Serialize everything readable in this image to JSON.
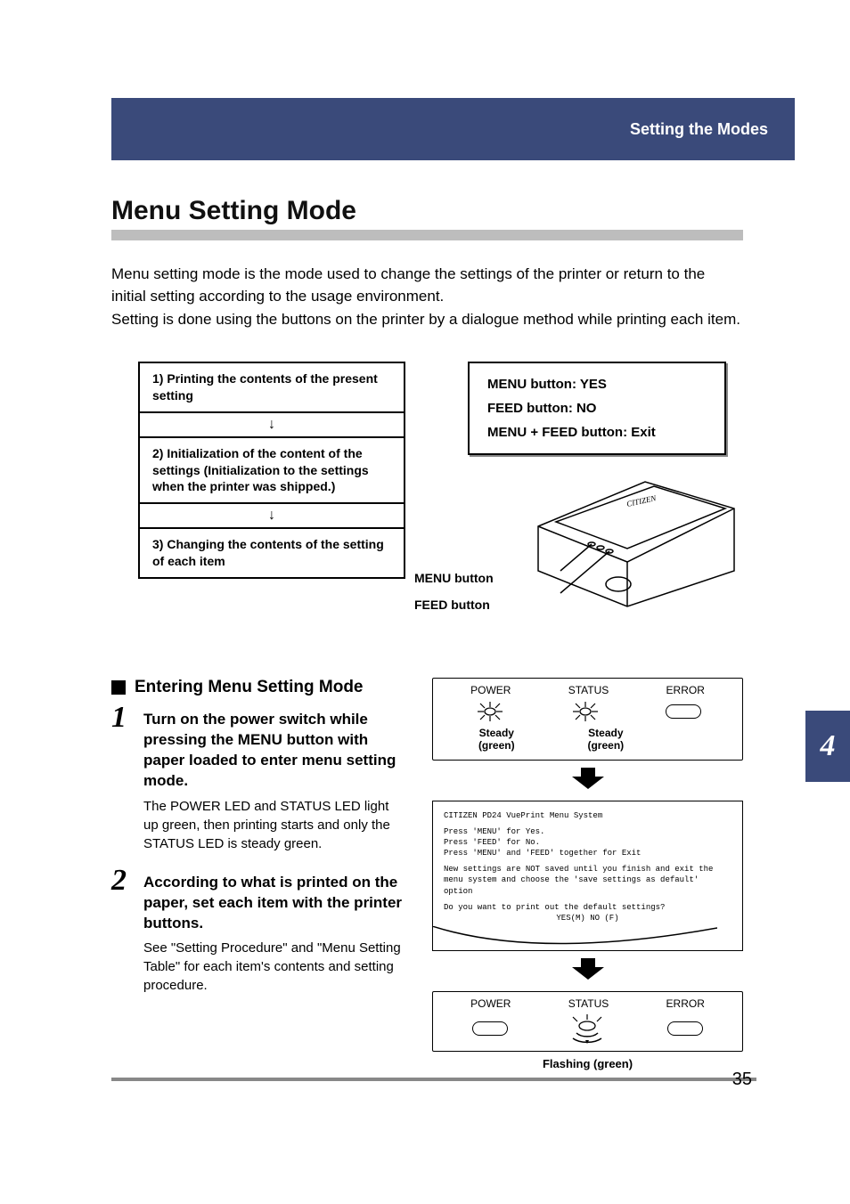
{
  "header": {
    "section": "Setting the Modes"
  },
  "title": "Menu Setting Mode",
  "intro": {
    "p1": "Menu setting mode is the mode used to change the settings of the printer or return to the initial setting according to the usage environment.",
    "p2": "Setting is done using the buttons on the printer by a dialogue method while printing each item."
  },
  "flow": {
    "box1": "1) Printing the contents of the present setting",
    "arrow": "↓",
    "box2": "2) Initialization of the content of the settings (Initialization to the settings when the printer was shipped.)",
    "box3": "3) Changing the contents of the setting of each item"
  },
  "legend": {
    "line1": "MENU button: YES",
    "line2": "FEED button: NO",
    "line3": "MENU + FEED button: Exit"
  },
  "callouts": {
    "menu": "MENU button",
    "feed": "FEED button"
  },
  "subhead": "Entering Menu Setting Mode",
  "steps": [
    {
      "num": "1",
      "title": "Turn on the power switch while pressing the MENU button with paper loaded to enter menu setting mode.",
      "body": "The POWER LED and STATUS LED light up green, then printing starts and only the STATUS LED is steady green."
    },
    {
      "num": "2",
      "title": "According to what is printed on the paper, set each item with the printer buttons.",
      "body": "See \"Setting Procedure\" and \"Menu Setting Table\" for each item's contents and setting procedure."
    }
  ],
  "led": {
    "labels": {
      "power": "POWER",
      "status": "STATUS",
      "error": "ERROR"
    },
    "caption_steady": "Steady\n(green)",
    "caption_flash": "Flashing (green)"
  },
  "printout": {
    "l1": "CITIZEN PD24 VuePrint Menu System",
    "l2": "Press 'MENU'  for Yes.",
    "l3": "Press 'FEED'  for No.",
    "l4": "Press 'MENU'  and 'FEED' together for Exit",
    "l5": "New settings are NOT saved until you finish and exit the menu system and choose the 'save settings as default' option",
    "l6": "Do you want to print out the default settings?",
    "l7": "YES(M)   NO (F)"
  },
  "side_tab": "4",
  "page_number": "35"
}
